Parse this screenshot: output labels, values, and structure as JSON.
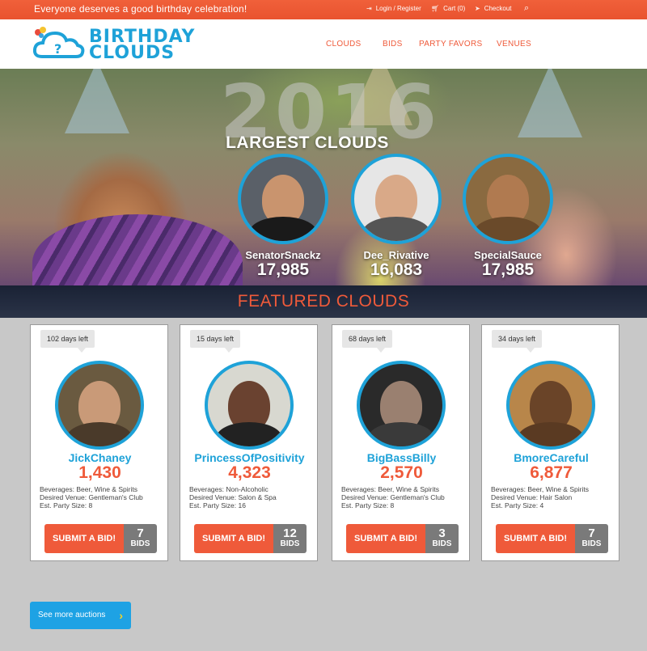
{
  "topbar": {
    "tagline": "Everyone deserves a good birthday celebration!",
    "login": "Login / Register",
    "cart": "Cart (0)",
    "checkout": "Checkout"
  },
  "logo": {
    "line1": "BIRTHDAY",
    "line2": "CLOUDS"
  },
  "nav": [
    "CLOUDS",
    "BIDS",
    "PARTY FAVORS",
    "VENUES"
  ],
  "hero": {
    "year": "2016",
    "title": "LARGEST CLOUDS",
    "leaders": [
      {
        "name": "SenatorSnackz",
        "score": "17,985"
      },
      {
        "name": "Dee_Rivative",
        "score": "16,083"
      },
      {
        "name": "SpecialSauce",
        "score": "17,985"
      }
    ]
  },
  "featured": {
    "title": "FEATURED CLOUDS",
    "bid_label": "SUBMIT A BID!",
    "bids_word": "BIDS",
    "cards": [
      {
        "days": "102 days left",
        "name": "JickChaney",
        "count": "1,430",
        "line1": "Beverages: Beer, Wine & Spirits",
        "line2": "Desired Venue:  Gentleman's Club",
        "line3": "Est. Party Size: 8",
        "bids": "7"
      },
      {
        "days": "15 days left",
        "name": "PrincessOfPositivity",
        "count": "4,323",
        "line1": "Beverages: Non-Alcoholic",
        "line2": "Desired Venue:  Salon & Spa",
        "line3": "Est. Party Size: 16",
        "bids": "12"
      },
      {
        "days": "68 days left",
        "name": "BigBassBilly",
        "count": "2,570",
        "line1": "Beverages: Beer, Wine & Spirits",
        "line2": "Desired Venue:  Gentleman's Club",
        "line3": "Est. Party Size: 8",
        "bids": "3"
      },
      {
        "days": "34 days left",
        "name": "BmoreCareful",
        "count": "6,877",
        "line1": "Beverages: Beer, Wine & Spirits",
        "line2": "Desired Venue:  Hair Salon",
        "line3": "Est. Party Size: 4",
        "bids": "7"
      }
    ]
  },
  "more_button": "See more auctions",
  "colors": {
    "accent": "#ef5a3a",
    "brand_blue": "#1ea2d8",
    "navy": "#1a2235"
  }
}
